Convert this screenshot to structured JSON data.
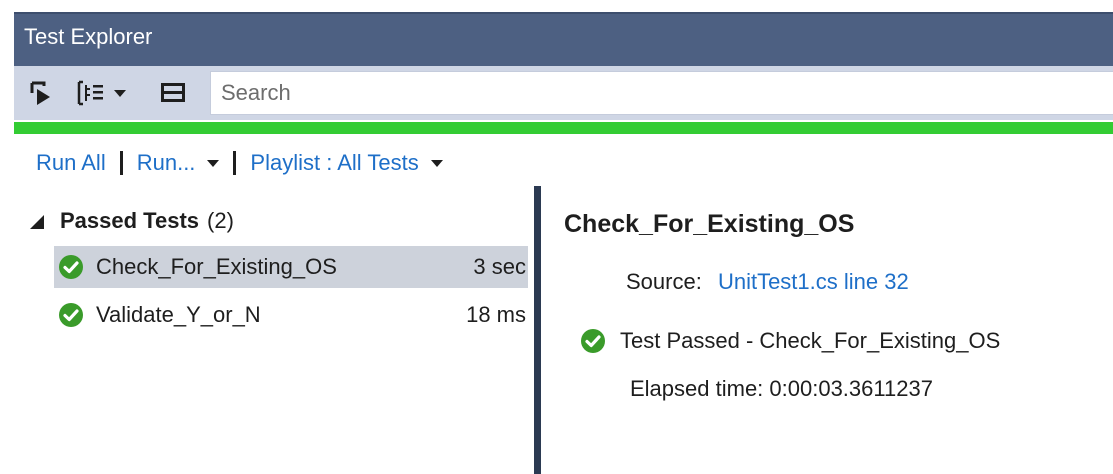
{
  "window": {
    "title": "Test Explorer"
  },
  "toolbar": {
    "run_icon": "run-tests-icon",
    "group_icon": "group-by-icon",
    "settings_icon": "playlist-settings-icon",
    "search_placeholder": "Search"
  },
  "progress": {
    "fraction": 1.0,
    "color": "#33cc33"
  },
  "commands": {
    "run_all": "Run All",
    "run": "Run...",
    "playlist": "Playlist : All Tests"
  },
  "group": {
    "name": "Passed Tests",
    "count": "(2)"
  },
  "tests": [
    {
      "name": "Check_For_Existing_OS",
      "duration": "3 sec",
      "status": "passed",
      "selected": true
    },
    {
      "name": "Validate_Y_or_N",
      "duration": "18 ms",
      "status": "passed",
      "selected": false
    }
  ],
  "detail": {
    "title": "Check_For_Existing_OS",
    "source_label": "Source:",
    "source_link": "UnitTest1.cs line 32",
    "result_text": "Test Passed - Check_For_Existing_OS",
    "elapsed": "Elapsed time: 0:00:03.3611237"
  },
  "colors": {
    "title_bar": "#4d6082",
    "toolbar": "#cfd6e5",
    "link": "#1e6fc8",
    "passed": "#3a9b2a",
    "selected_row": "#cdd2db"
  }
}
